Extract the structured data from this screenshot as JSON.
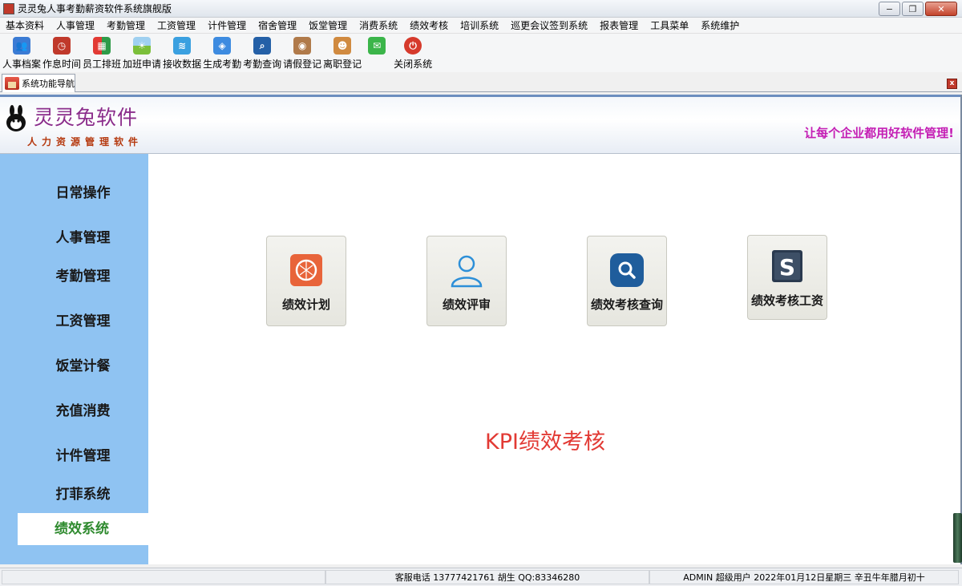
{
  "window": {
    "title": "灵灵兔人事考勤薪资软件系统旗舰版",
    "min_label": "−",
    "max_label": "❐",
    "close_label": "✕"
  },
  "menu": [
    "基本资料",
    "人事管理",
    "考勤管理",
    "工资管理",
    "计件管理",
    "宿舍管理",
    "饭堂管理",
    "消费系统",
    "绩效考核",
    "培训系统",
    "巡更会议签到系统",
    "报表管理",
    "工具菜单",
    "系统维护"
  ],
  "toolbar": [
    {
      "label": "人事档案",
      "icon": "people-icon",
      "color": "#3b7bd4"
    },
    {
      "label": "作息时间",
      "icon": "clock-icon",
      "color": "#c0392b"
    },
    {
      "label": "员工排班",
      "icon": "grid-icon",
      "color": "#2e9b48"
    },
    {
      "label": "加班申请",
      "icon": "landscape-icon",
      "color": "#7bbf3a"
    },
    {
      "label": "接收数据",
      "icon": "wifi-icon",
      "color": "#3aa0e0"
    },
    {
      "label": "生成考勤",
      "icon": "box-icon",
      "color": "#3d8be0"
    },
    {
      "label": "考勤查询",
      "icon": "search-icon",
      "color": "#2460a7"
    },
    {
      "label": "请假登记",
      "icon": "camera-icon",
      "color": "#b07a4a"
    },
    {
      "label": "离职登记",
      "icon": "person-icon",
      "color": "#d08a40"
    },
    {
      "label": "",
      "icon": "chat-icon",
      "color": "#3bb54a"
    },
    {
      "label": "关闭系统",
      "icon": "power-icon",
      "color": "#d63a2c"
    }
  ],
  "tab": {
    "label": "系统功能导航",
    "close_label": "x"
  },
  "banner": {
    "title": "灵灵兔软件",
    "subtitle": "人力资源管理软件",
    "slogan": "让每个企业都用好软件管理!"
  },
  "sidebar": [
    "日常操作",
    "人事管理",
    "考勤管理",
    "工资管理",
    "饭堂计餐",
    "充值消费",
    "计件管理",
    "打菲系统",
    "绩效系统"
  ],
  "sidebar_active": "绩效系统",
  "cards": [
    {
      "label": "绩效计划",
      "icon": "plan-icon"
    },
    {
      "label": "绩效评审",
      "icon": "user-outline-icon"
    },
    {
      "label": "绩效考核查询",
      "icon": "search-icon"
    },
    {
      "label": "绩效考核工资",
      "icon": "s-logo-icon"
    }
  ],
  "main_heading": "KPI绩效考核",
  "status": {
    "service": "客服电话 13777421761 胡生 QQ:83346280",
    "user": "ADMIN 超级用户 2022年01月12日星期三 辛丑牛年腊月初十"
  },
  "colors": {
    "sidebar": "#8fc3f2",
    "active_text": "#2e8a2e",
    "kpi": "#e23a34",
    "slogan": "#c41eb4",
    "title": "#8b2d8b"
  }
}
